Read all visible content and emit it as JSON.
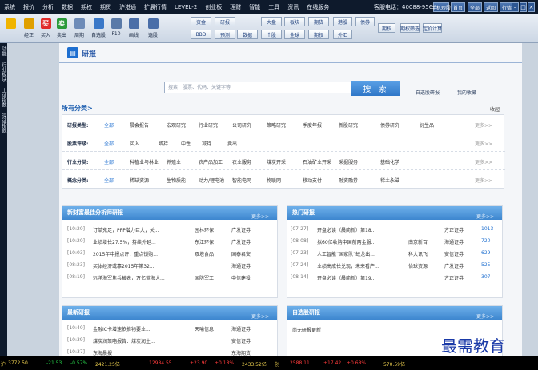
{
  "menu": [
    "系统",
    "报价",
    "分析",
    "数据",
    "期权",
    "期货",
    "沪港通",
    "扩展行情",
    "LEVEL-2",
    "创业板",
    "理财",
    "智能",
    "工具",
    "资讯",
    "在线服务"
  ],
  "phone": "客服电话：40088-95618",
  "top_buttons": [
    "手机炒股",
    "首页",
    "全部",
    "返回",
    "行情"
  ],
  "toolbar_left": [
    {
      "label": "",
      "icon": "back-arrow-icon",
      "color": "#f0b400"
    },
    {
      "label": "经正",
      "icon": "star-icon",
      "color": "#e0a000"
    },
    {
      "label": "买入",
      "icon": "buy-icon",
      "color": "#e02a2a",
      "glyph": "买"
    },
    {
      "label": "卖出",
      "icon": "sell-icon",
      "color": "#2a9a3a",
      "glyph": "卖"
    },
    {
      "label": "周期",
      "icon": "cycle-icon",
      "color": "#6d8bb8"
    },
    {
      "label": "自选股",
      "icon": "watchlist-icon",
      "color": "#3a78c8"
    },
    {
      "label": "F10",
      "icon": "f10-icon",
      "color": "#5a7aa8"
    },
    {
      "label": "画线",
      "icon": "draw-line-icon",
      "color": "#4a6ea8"
    },
    {
      "label": "选股",
      "icon": "stock-pick-icon",
      "color": "#4a6ea8"
    }
  ],
  "toolbar_groups": [
    [
      "资金",
      "研报",
      "BBD",
      "预测"
    ],
    [
      "数据",
      "大盘",
      "个股",
      "板块",
      "全球",
      "期货",
      "期权"
    ],
    [
      "港股",
      "外汇",
      "债券",
      "期权",
      "期权筛选",
      "定价计算"
    ]
  ],
  "side_tabs": [
    "功能",
    "行业板块",
    "上证指数",
    "深证指数"
  ],
  "brand": "研报",
  "search": {
    "placeholder": "搜索：股票、代码、关键字等",
    "button": "搜 索"
  },
  "top_links": [
    "自选股研报",
    "我的收藏"
  ],
  "all_categories": "所有分类>",
  "collapse": "收起",
  "more": "更多>>",
  "categories": [
    {
      "label": "研报类型:",
      "items": [
        "全部",
        "晨会报告",
        "宏观研究",
        "行业研究",
        "公司研究",
        "策略研究",
        "季度年报",
        "新股研究",
        "债券研究",
        "衍生品"
      ]
    },
    {
      "label": "股票评级:",
      "items": [
        "全部",
        "买入",
        "增持",
        "中性",
        "减持",
        "卖出"
      ]
    },
    {
      "label": "行业分类:",
      "items": [
        "全部",
        "种植业与林业",
        "养殖业",
        "农产品加工",
        "农业服务",
        "煤炭开采",
        "石油矿业开采",
        "采掘服务",
        "基础化学"
      ]
    },
    {
      "label": "概念分类:",
      "items": [
        "全部",
        "稀缺资源",
        "生物质能",
        "动力/锂电池",
        "智能电网",
        "物联网",
        "移动支付",
        "融资融券",
        "稀土永磁"
      ]
    }
  ],
  "panels": {
    "analyst": {
      "title": "新财富最佳分析师研报",
      "rows": [
        {
          "date": "[10:20]",
          "title": "订单充足，PPP潜力巨大；关...",
          "sector": "园林环保",
          "broker": "广发证券"
        },
        {
          "date": "[10:20]",
          "title": "业绩增长27.5%，持续外延...",
          "sector": "东江环保",
          "broker": "广发证券"
        },
        {
          "date": "[10:03]",
          "title": "2015年中报点评：重点锁购...",
          "sector": "双塔食品",
          "broker": "国泰君安"
        },
        {
          "date": "[08:23]",
          "title": "买体经济或靠2015年第32...",
          "sector": "",
          "broker": "海通证券"
        },
        {
          "date": "[08:19]",
          "title": "远洋海军焦兵被表，万亿蓝海大...",
          "sector": "国防军工",
          "broker": "中信建投"
        }
      ]
    },
    "hot": {
      "title": "热门研报",
      "rows": [
        {
          "date": "[07-27]",
          "title": "开盘必读（晨简新）第18...",
          "company": "",
          "broker": "方正证券",
          "count": "1013"
        },
        {
          "date": "[08-08]",
          "title": "拟60亿收购中国前两金服...",
          "company": "南京新百",
          "broker": "海通证券",
          "count": "720"
        },
        {
          "date": "[07-23]",
          "title": "人工智能“国家队”蛟龙出...",
          "company": "科大讯飞",
          "broker": "安信证券",
          "count": "629"
        },
        {
          "date": "[07-24]",
          "title": "业绩高成长兑现，未来看产...",
          "company": "怡球资源",
          "broker": "广发证券",
          "count": "525"
        },
        {
          "date": "[08-14]",
          "title": "开盘必读（晨简新）第19...",
          "company": "",
          "broker": "方正证券",
          "count": "307"
        }
      ]
    },
    "latest": {
      "title": "最新研报",
      "rows": [
        {
          "date": "[10:40]",
          "title": "金融IC卡增速依推物要业...",
          "sector": "天喻信息",
          "broker": "海通证券"
        },
        {
          "date": "[10:39]",
          "title": "煤炭润策略报告：煤炭润生...",
          "sector": "",
          "broker": "安信证券"
        },
        {
          "date": "[10:37]",
          "title": "东海晨报",
          "sector": "",
          "broker": "东海期货"
        }
      ]
    },
    "watch": {
      "title": "自选股研报",
      "empty": "尚无研报更新"
    }
  },
  "ticker": [
    {
      "label": "沪",
      "value": "3772.50",
      "cls": "yw"
    },
    {
      "value": "-21.53",
      "cls": "dn"
    },
    {
      "value": "-0.57%",
      "cls": "dn"
    },
    {
      "value": "2421.25亿",
      "cls": "yw"
    },
    {
      "value": "12984.55",
      "cls": "up"
    },
    {
      "value": "+23.90",
      "cls": "up"
    },
    {
      "value": "+0.18%",
      "cls": "up"
    },
    {
      "value": "2433.52亿",
      "cls": "yw"
    },
    {
      "value": "创",
      "cls": "yw"
    },
    {
      "value": "2588.11",
      "cls": "up"
    },
    {
      "value": "+17.42",
      "cls": "up"
    },
    {
      "value": "+0.68%",
      "cls": "up"
    },
    {
      "value": "570.59亿",
      "cls": "yw"
    }
  ],
  "watermark": "最需教育"
}
